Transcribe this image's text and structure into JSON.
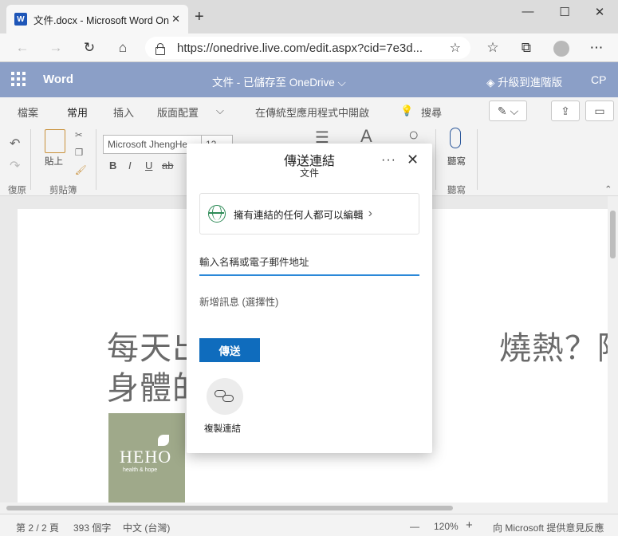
{
  "browser": {
    "tab_title": "文件.docx - Microsoft Word Online",
    "tab_icon": "W",
    "url": "https://onedrive.live.com/edit.aspx?cid=7e3d..."
  },
  "word": {
    "app_name": "Word",
    "doc_title": "文件 - 已儲存至 OneDrive ⌵",
    "upgrade": "升級到進階版",
    "initials": "CP"
  },
  "ribbon_tabs": [
    "檔案",
    "常用",
    "插入",
    "版面配置",
    "⌵",
    "在傳統型應用程式中開啟",
    "搜尋"
  ],
  "ribbon": {
    "paste_label": "貼上",
    "font_name": "Microsoft JhengHe...",
    "font_size": "12",
    "groups": [
      "復原",
      "剪貼簿",
      "聽寫"
    ],
    "dictate_label": "聽寫",
    "format_buttons": [
      "B",
      "I",
      "U",
      "ab"
    ]
  },
  "document": {
    "line1": "每天出　　　　　　　　　燒熱？除了水",
    "line2": "身體的",
    "logo_big": "HEHO",
    "logo_small": "health & hope"
  },
  "dialog": {
    "title": "傳送連結",
    "subtitle": "文件",
    "permission": "擁有連結的任何人都可以編輯",
    "name_placeholder": "輸入名稱或電子郵件地址",
    "message_placeholder": "新增訊息 (選擇性)",
    "send_label": "傳送",
    "copy_label": "複製連結"
  },
  "status": {
    "page": "第 2 / 2 頁",
    "words": "393 個字",
    "language": "中文 (台灣)",
    "zoom_minus": "—",
    "zoom": "120%",
    "zoom_plus": "+",
    "feedback": "向 Microsoft 提供意見反應"
  }
}
